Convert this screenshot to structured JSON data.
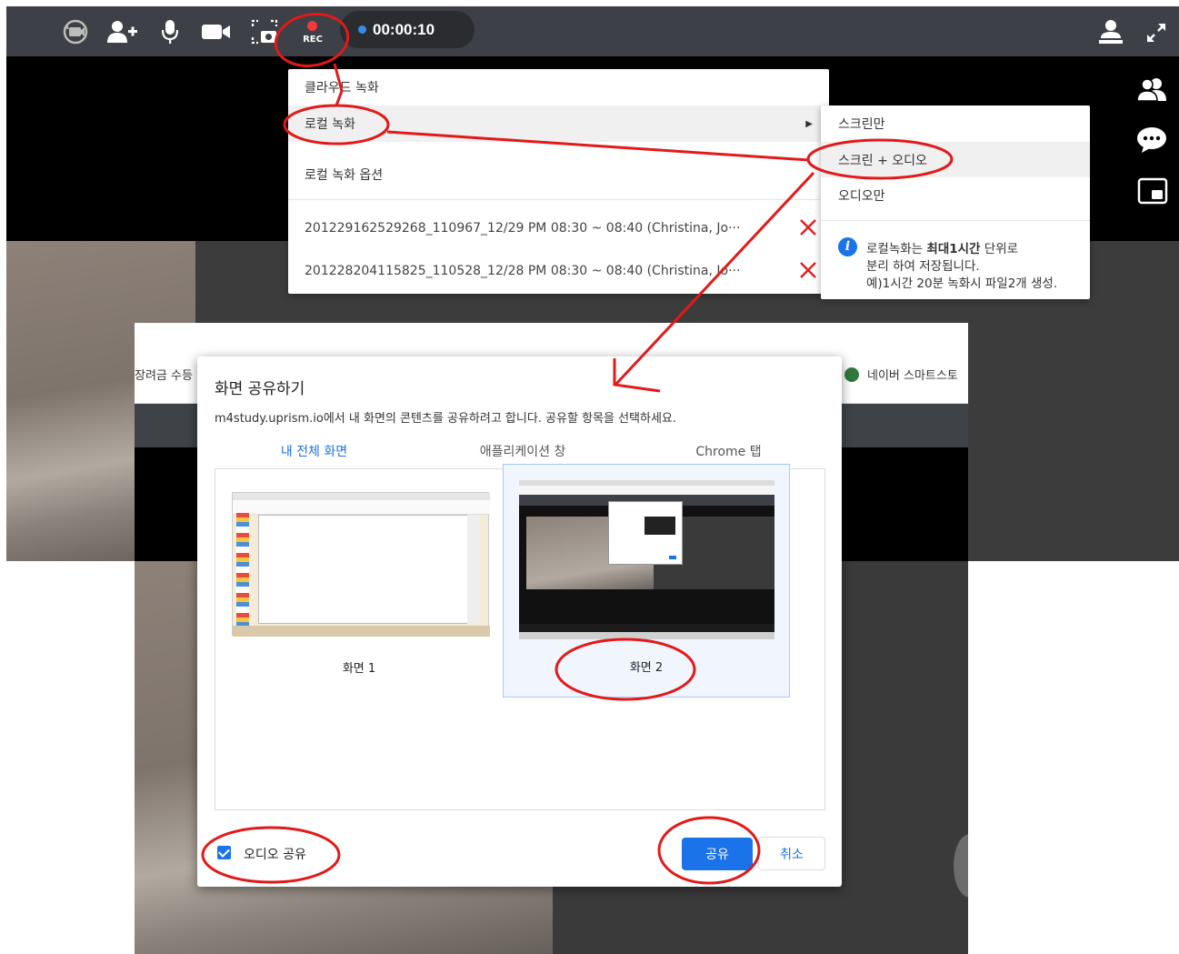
{
  "toolbar": {
    "icons": [
      "switch-camera-icon",
      "add-user-icon",
      "microphone-icon",
      "video-camera-icon",
      "screenshot-icon"
    ],
    "rec_label": "REC",
    "timer": "00:00:10",
    "right_icons": [
      "participant-view-icon",
      "expand-icon"
    ]
  },
  "side_icons": [
    "participants-icon",
    "chat-icon",
    "picture-in-picture-icon"
  ],
  "record_menu": {
    "cloud": "클라우드 녹화",
    "local": "로컬 녹화",
    "options": "로컬 녹화 옵션",
    "files": [
      "201229162529268_110967_12/29 PM 08:30 ~ 08:40 (Christina, Jo···",
      "201228204115825_110528_12/28 PM 08:30 ~ 08:40 (Christina, Jo···"
    ]
  },
  "record_submenu": {
    "screen_only": "스크린만",
    "screen_audio": "스크린 + 오디오",
    "audio_only": "오디오만",
    "info": {
      "line1_pre": "로컬녹화는 ",
      "line1_bold": "최대1시간",
      "line1_post": " 단위로",
      "line2": "분리 하여 저장됩니다.",
      "line3": "예)1시간 20분 녹화시 파일2개 생성."
    }
  },
  "browser": {
    "bookmark_left": "장려금 수등",
    "bookmark_right": "네이버 스마트스토"
  },
  "share_dialog": {
    "title": "화면 공유하기",
    "description": "m4study.uprism.io에서 내 화면의 콘텐츠를 공유하려고 합니다. 공유할 항목을 선택하세요.",
    "tabs": [
      "내 전체 화면",
      "애플리케이션 창",
      "Chrome 탭"
    ],
    "selected_tab": 0,
    "screens": [
      "화면 1",
      "화면 2"
    ],
    "selected_screen": 1,
    "audio_share_label": "오디오 공유",
    "audio_share_checked": true,
    "share_button": "공유",
    "cancel_button": "취소"
  },
  "colors": {
    "toolbar": "#3d4046",
    "accent_blue": "#1a73e8",
    "annotation_red": "#e31919",
    "rec_dot": "#f23a3a"
  }
}
